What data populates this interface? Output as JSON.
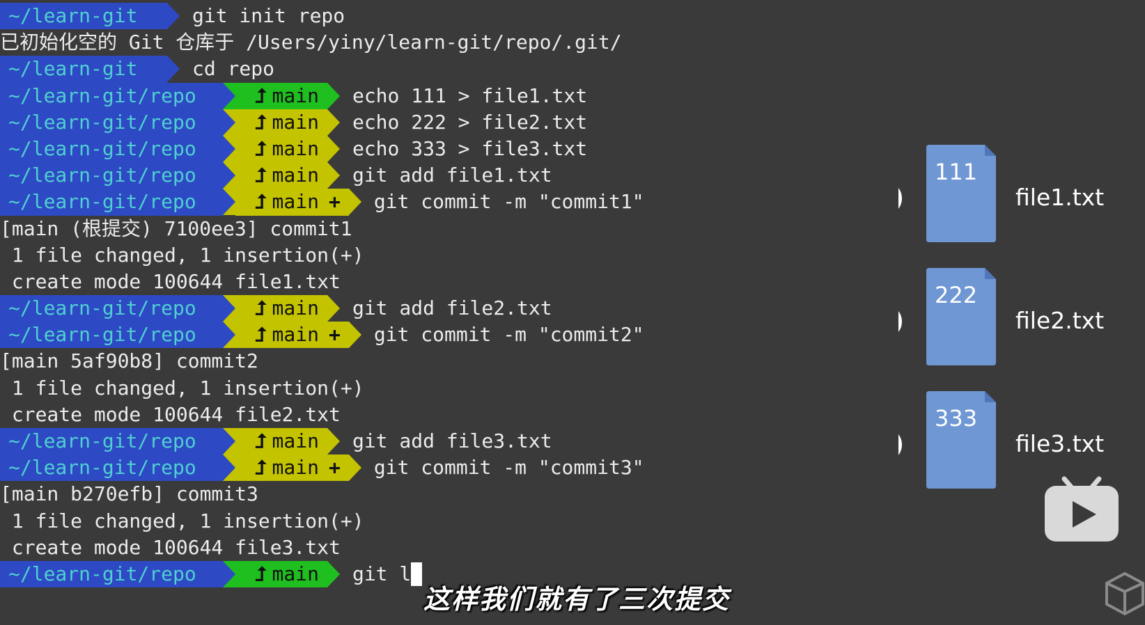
{
  "terminal": {
    "lines": [
      {
        "kind": "prompt-short",
        "path": "~/learn-git",
        "command": "git init repo"
      },
      {
        "kind": "output",
        "text": "已初始化空的 Git 仓库于 /Users/yiny/learn-git/repo/.git/"
      },
      {
        "kind": "prompt-short",
        "path": "~/learn-git",
        "command": "cd repo"
      },
      {
        "kind": "prompt-branch",
        "path": "~/learn-git/repo",
        "branch": "main",
        "state": "clean",
        "command": "echo 111 > file1.txt"
      },
      {
        "kind": "prompt-branch",
        "path": "~/learn-git/repo",
        "branch": "main",
        "state": "dirty",
        "command": "echo 222 > file2.txt"
      },
      {
        "kind": "prompt-branch",
        "path": "~/learn-git/repo",
        "branch": "main",
        "state": "dirty",
        "command": "echo 333 > file3.txt"
      },
      {
        "kind": "prompt-branch",
        "path": "~/learn-git/repo",
        "branch": "main",
        "state": "dirty",
        "command": "git add file1.txt"
      },
      {
        "kind": "prompt-branch",
        "path": "~/learn-git/repo",
        "branch": "main",
        "state": "dirty",
        "staged": "+",
        "command": "git commit -m \"commit1\""
      },
      {
        "kind": "output",
        "text": "[main (根提交) 7100ee3] commit1"
      },
      {
        "kind": "output",
        "text": " 1 file changed, 1 insertion(+)"
      },
      {
        "kind": "output",
        "text": " create mode 100644 file1.txt"
      },
      {
        "kind": "prompt-branch",
        "path": "~/learn-git/repo",
        "branch": "main",
        "state": "dirty",
        "command": "git add file2.txt"
      },
      {
        "kind": "prompt-branch",
        "path": "~/learn-git/repo",
        "branch": "main",
        "state": "dirty",
        "staged": "+",
        "command": "git commit -m \"commit2\""
      },
      {
        "kind": "output",
        "text": "[main 5af90b8] commit2"
      },
      {
        "kind": "output",
        "text": " 1 file changed, 1 insertion(+)"
      },
      {
        "kind": "output",
        "text": " create mode 100644 file2.txt"
      },
      {
        "kind": "prompt-branch",
        "path": "~/learn-git/repo",
        "branch": "main",
        "state": "dirty",
        "command": "git add file3.txt"
      },
      {
        "kind": "prompt-branch",
        "path": "~/learn-git/repo",
        "branch": "main",
        "state": "dirty",
        "staged": "+",
        "command": "git commit -m \"commit3\""
      },
      {
        "kind": "output",
        "text": "[main b270efb] commit3"
      },
      {
        "kind": "output",
        "text": " 1 file changed, 1 insertion(+)"
      },
      {
        "kind": "output",
        "text": " create mode 100644 file3.txt"
      },
      {
        "kind": "prompt-branch",
        "path": "~/learn-git/repo",
        "branch": "main",
        "state": "clean",
        "command": "git l",
        "cursor": true
      }
    ],
    "branch_glyph": "⮥",
    "colors": {
      "path_bg": "#2d49c4",
      "path_fg": "#4fd0d0",
      "branch_clean_bg": "#1fbf1f",
      "branch_dirty_bg": "#c3c300",
      "text": "#ececec",
      "background": "#3a3a3a"
    }
  },
  "diagram": {
    "commits": [
      {
        "content": "111",
        "filename": "file1.txt"
      },
      {
        "content": "222",
        "filename": "file2.txt"
      },
      {
        "content": "333",
        "filename": "file3.txt"
      }
    ],
    "colors": {
      "file_fill": "#6f97d4",
      "file_fold": "#4f76b8",
      "line": "#ffffff"
    }
  },
  "subtitle": "这样我们就有了三次提交",
  "icons": {
    "play_badge": "play-icon",
    "watermark": "logo-watermark-icon"
  }
}
